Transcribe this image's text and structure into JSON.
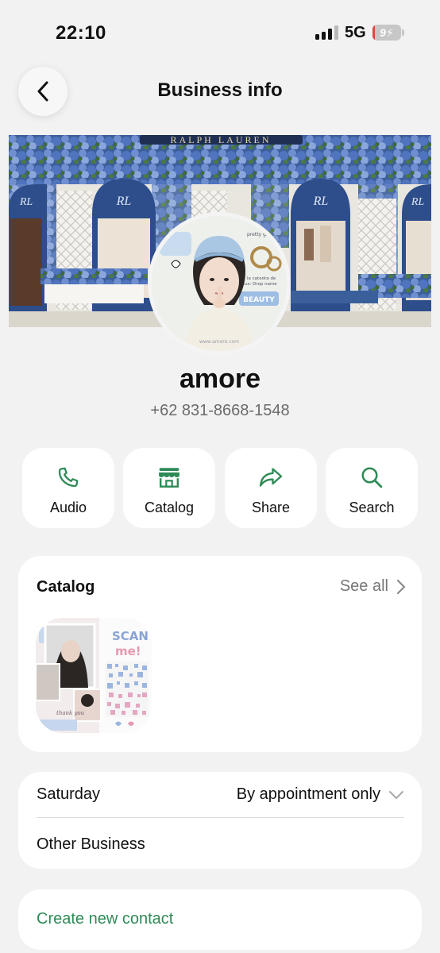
{
  "status_bar": {
    "time": "22:10",
    "network": "5G",
    "battery_level": "9",
    "battery_color": "#e0463b",
    "signal_bars_active": 3,
    "signal_bars_total": 4
  },
  "header": {
    "back_icon": "chevron-left-icon",
    "title": "Business info"
  },
  "cover": {
    "description_icon": "storefront-photo",
    "sign_text": "RALPH LAUREN",
    "accent_color": "#2d4e8a"
  },
  "profile": {
    "name": "amore",
    "phone": "+62 831-8668-1548"
  },
  "actions": [
    {
      "label": "Audio",
      "icon": "phone-icon"
    },
    {
      "label": "Catalog",
      "icon": "store-icon"
    },
    {
      "label": "Share",
      "icon": "share-arrow-icon"
    },
    {
      "label": "Search",
      "icon": "search-icon"
    }
  ],
  "accent_color": "#2e8b57",
  "catalog": {
    "title": "Catalog",
    "see_all": "See all",
    "items": [
      {
        "image": "collage-scan-me-photo",
        "overlay_text": "Scan me!"
      }
    ]
  },
  "hours": {
    "day": "Saturday",
    "value": "By appointment only",
    "other": "Other Business"
  },
  "contact": {
    "create_label": "Create new contact"
  }
}
